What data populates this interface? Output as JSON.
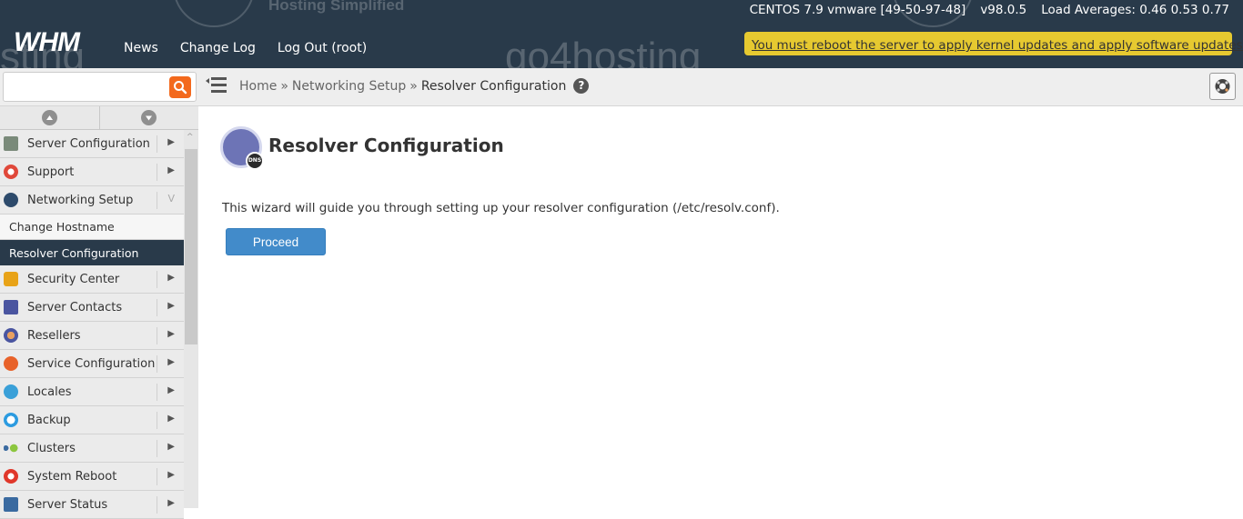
{
  "header": {
    "logo": "WHM",
    "nav": [
      "News",
      "Change Log",
      "Log Out (root)"
    ],
    "system": {
      "os": "CENTOS 7.9 vmware [49-50-97-48]",
      "version": "v98.0.5",
      "load": "Load Averages: 0.46 0.53 0.77"
    },
    "notice": "You must reboot the server to apply kernel updates and apply software updates.",
    "notice_color": "#e6c930",
    "bg_color": "#293a4a"
  },
  "watermark": {
    "brand": "go4hosting",
    "tagline": "Hosting Simplified"
  },
  "search": {
    "value": "",
    "placeholder": ""
  },
  "breadcrumb": {
    "items": [
      "Home",
      "Networking Setup",
      "Resolver Configuration"
    ],
    "separator": "»",
    "help": "?"
  },
  "sidebar": {
    "items": [
      {
        "label": "Server Configuration",
        "icon": "server-config-icon",
        "color": "#6b8a6b"
      },
      {
        "label": "Support",
        "icon": "lifebuoy-icon",
        "color": "#e0483a"
      },
      {
        "label": "Networking Setup",
        "icon": "network-icon",
        "color": "#2d4a6b",
        "expanded": true,
        "children": [
          {
            "label": "Change Hostname"
          },
          {
            "label": "Resolver Configuration",
            "active": true
          }
        ]
      },
      {
        "label": "Security Center",
        "icon": "lock-icon",
        "color": "#e8a318"
      },
      {
        "label": "Server Contacts",
        "icon": "contacts-icon",
        "color": "#4a55a0"
      },
      {
        "label": "Resellers",
        "icon": "tag-icon",
        "color": "#4a55a0"
      },
      {
        "label": "Service Configuration",
        "icon": "wrench-icon",
        "color": "#e8622a"
      },
      {
        "label": "Locales",
        "icon": "chat-icon",
        "color": "#3aa0d8"
      },
      {
        "label": "Backup",
        "icon": "backup-icon",
        "color": "#2c9be0"
      },
      {
        "label": "Clusters",
        "icon": "clusters-icon",
        "color": "#8cc63f"
      },
      {
        "label": "System Reboot",
        "icon": "power-icon",
        "color": "#e0372a"
      },
      {
        "label": "Server Status",
        "icon": "status-icon",
        "color": "#3a6aa0"
      }
    ]
  },
  "main": {
    "title": "Resolver Configuration",
    "icon_badge": "DNS",
    "description": "This wizard will guide you through setting up your resolver configuration (/etc/resolv.conf).",
    "proceed_label": "Proceed"
  }
}
